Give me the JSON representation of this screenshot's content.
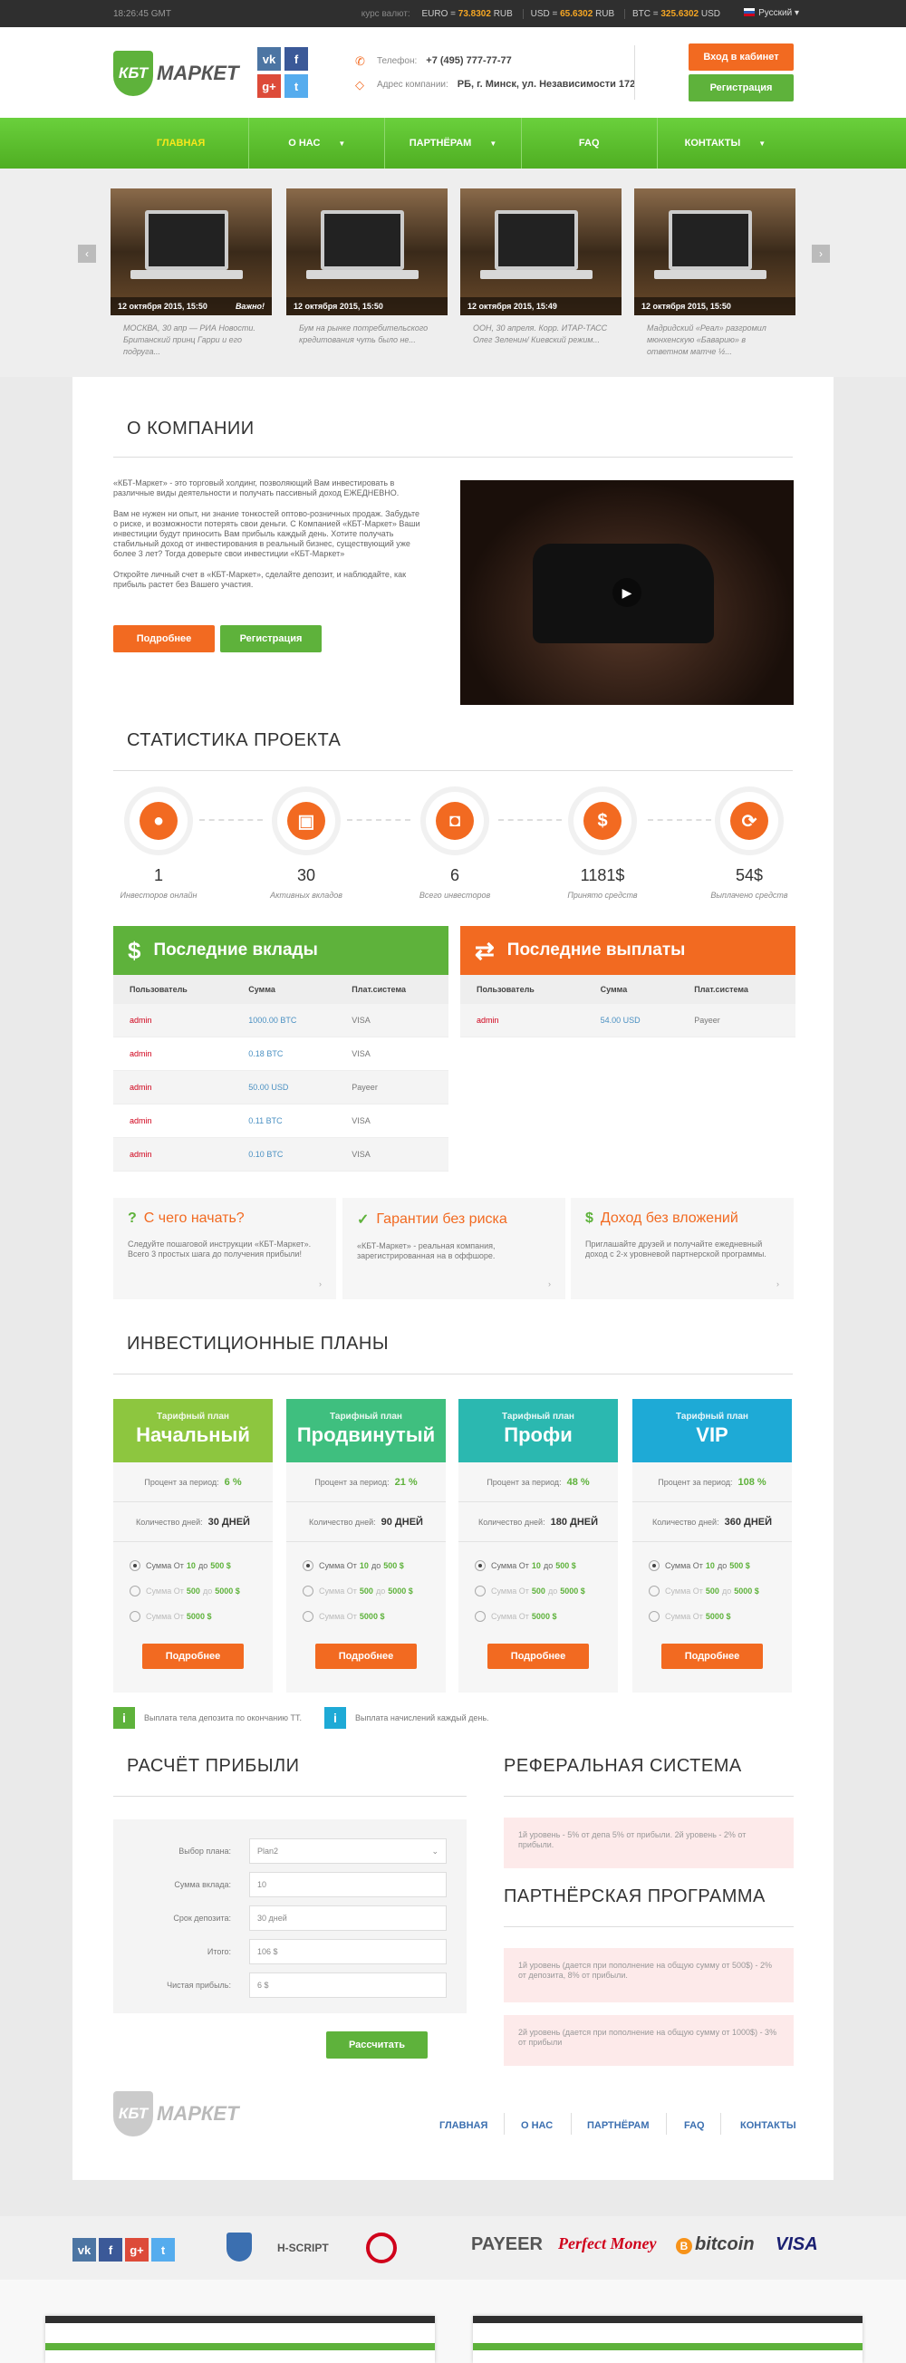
{
  "topbar": {
    "time": "18:26:45 GMT",
    "rates_label": "курс валют:",
    "euro_label": "EURO =",
    "euro_value": "73.8302",
    "euro_unit": "RUB",
    "usd_label": "USD =",
    "usd_value": "65.6302",
    "usd_unit": "RUB",
    "btc_label": "BTC =",
    "btc_value": "325.6302",
    "btc_unit": "USD",
    "language": "Русский"
  },
  "header": {
    "logo_mark": "КБТ",
    "logo_text": "МАРКЕТ",
    "phone_label": "Телефон:",
    "phone": "+7 (495) 777-77-77",
    "address_label": "Адрес компании:",
    "address": "РБ, г. Минск, ул. Независимости 172",
    "cabinet_button": "Вход в кабинет",
    "register_button": "Регистрация",
    "social": [
      "vk",
      "f",
      "g+",
      "t"
    ]
  },
  "nav": [
    {
      "label": "ГЛАВНАЯ"
    },
    {
      "label": "О НАС",
      "dropdown": true
    },
    {
      "label": "ПАРТНЁРАМ",
      "dropdown": true
    },
    {
      "label": "FAQ"
    },
    {
      "label": "КОНТАКТЫ",
      "dropdown": true
    }
  ],
  "slider": [
    {
      "date": "12 октября 2015, 15:50",
      "tag": "Важно!",
      "caption": "МОСКВА, 30 апр — РИА Новости. Британский принц Гарри и его подруга..."
    },
    {
      "date": "12 октября 2015, 15:50",
      "tag": "",
      "caption": "Бум на рынке потребительского кредитования чуть было не..."
    },
    {
      "date": "12 октября 2015, 15:49",
      "tag": "",
      "caption": "ООН, 30 апреля. Корр. ИТАР-ТАСС Олег Зеленин/ Киевский режим..."
    },
    {
      "date": "12 октября 2015, 15:50",
      "tag": "",
      "caption": "Мадридский «Реал» разгромил мюнхенскую «Баварию» в ответном матче ½..."
    }
  ],
  "about": {
    "title": "О КОМПАНИИ",
    "p1": "«КБТ-Маркет» - это торговый холдинг, позволяющий Вам инвестировать в различные виды деятельности и получать пассивный доход ЕЖЕДНЕВНО.",
    "p2": "Вам не нужен ни опыт, ни знание тонкостей оптово-розничных продаж. Забудьте о риске, и возможности потерять свои деньги. С Компанией «КБТ-Маркет» Ваши инвестиции будут приносить Вам прибыль каждый день. Хотите получать стабильный доход от инвестирования в реальный бизнес, существующий уже более 3 лет? Тогда доверьте свои инвестиции «КБТ-Маркет»",
    "p3": "Откройте личный счет в «КБТ-Маркет», сделайте депозит, и наблюдайте, как прибыль растет без Вашего участия.",
    "more_button": "Подробнее",
    "register_button": "Регистрация"
  },
  "stats": {
    "title": "СТАТИСТИКА ПРОЕКТА",
    "items": [
      {
        "icon": "user-icon",
        "glyph": "●",
        "value": "1",
        "label": "Инвесторов онлайн"
      },
      {
        "icon": "wallet-icon",
        "glyph": "▣",
        "value": "30",
        "label": "Активных вкладов"
      },
      {
        "icon": "investors-icon",
        "glyph": "◘",
        "value": "6",
        "label": "Всего инвесторов"
      },
      {
        "icon": "dollar-icon",
        "glyph": "$",
        "value": "1181$",
        "label": "Принято средств"
      },
      {
        "icon": "refresh-icon",
        "glyph": "⟳",
        "value": "54$",
        "label": "Выплачено средств"
      }
    ]
  },
  "deposits": {
    "title": "Последние вклады",
    "columns": [
      "Пользователь",
      "Сумма",
      "Плат.система"
    ],
    "rows": [
      [
        "admin",
        "1000.00 BTC",
        "VISA"
      ],
      [
        "admin",
        "0.18 BTC",
        "VISA"
      ],
      [
        "admin",
        "50.00 USD",
        "Payeer"
      ],
      [
        "admin",
        "0.11 BTC",
        "VISA"
      ],
      [
        "admin",
        "0.10 BTC",
        "VISA"
      ]
    ]
  },
  "payouts": {
    "title": "Последние выплаты",
    "columns": [
      "Пользователь",
      "Сумма",
      "Плат.система"
    ],
    "rows": [
      [
        "admin",
        "54.00 USD",
        "Payeer"
      ]
    ]
  },
  "info": [
    {
      "icon": "?",
      "title": "С чего начать?",
      "text": "Следуйте пошаговой инструкции «КБТ-Маркет». Всего 3 простых шага до получения прибыли!"
    },
    {
      "icon": "✓",
      "title": "Гарантии без риска",
      "text": "«КБТ-Маркет» - реальная компания, зарегистрированная на в оффшоре."
    },
    {
      "icon": "$",
      "title": "Доход без вложений",
      "text": "Приглашайте друзей и получайте ежедневный доход с 2-х уровневой партнерской программы."
    }
  ],
  "plans": {
    "title": "ИНВЕСТИЦИОННЫЕ ПЛАНЫ",
    "subtitle": "Тарифный план",
    "percent_label": "Процент за период:",
    "days_label": "Количество дней:",
    "sum_label": "Сумма",
    "from": "От",
    "to": "до",
    "button": "Подробнее",
    "items": [
      {
        "name": "Начальный",
        "color": "#8dc63f",
        "percent": "6 %",
        "days": "30 ДНЕЙ",
        "ranges": [
          [
            "10",
            "500 $"
          ],
          [
            "500",
            "5000 $"
          ],
          [
            "5000 $",
            ""
          ]
        ]
      },
      {
        "name": "Продвинутый",
        "color": "#3fbf7f",
        "percent": "21 %",
        "days": "90 ДНЕЙ",
        "ranges": [
          [
            "10",
            "500 $"
          ],
          [
            "500",
            "5000 $"
          ],
          [
            "5000 $",
            ""
          ]
        ]
      },
      {
        "name": "Профи",
        "color": "#2bb8b0",
        "percent": "48 %",
        "days": "180 ДНЕЙ",
        "ranges": [
          [
            "10",
            "500 $"
          ],
          [
            "500",
            "5000 $"
          ],
          [
            "5000 $",
            ""
          ]
        ]
      },
      {
        "name": "VIP",
        "color": "#1eaad6",
        "percent": "108 %",
        "days": "360 ДНЕЙ",
        "ranges": [
          [
            "10",
            "500 $"
          ],
          [
            "500",
            "5000 $"
          ],
          [
            "5000 $",
            ""
          ]
        ]
      }
    ]
  },
  "notes": [
    "Выплата тела депозита по окончанию TT.",
    "Выплата начислений каждый день."
  ],
  "calc": {
    "title": "РАСЧЁТ ПРИБЫЛИ",
    "fields": [
      {
        "label": "Выбор плана:",
        "value": "Plan2"
      },
      {
        "label": "Сумма вклада:",
        "value": "10"
      },
      {
        "label": "Срок депозита:",
        "value": "30 дней"
      },
      {
        "label": "Итого:",
        "value": "106 $"
      },
      {
        "label": "Чистая прибыль:",
        "value": "6 $"
      }
    ],
    "button": "Рассчитать"
  },
  "referral": {
    "title": "РЕФЕРАЛЬНАЯ СИСТЕМА",
    "text": "1й уровень - 5% от депа 5% от прибыли. 2й уровень - 2% от прибыли.",
    "partner_title": "ПАРТНЁРСКАЯ ПРОГРАММА",
    "partner1": "1й уровень (дается при пополнение на общую сумму от 500$) - 2% от депозита, 8% от прибыли.",
    "partner2": "2й уровень (дается при пополнение на общую сумму от 1000$) - 3% от прибыли"
  },
  "footer_nav": [
    "ГЛАВНАЯ",
    "О НАС",
    "ПАРТНЁРАМ",
    "FAQ",
    "КОНТАКТЫ"
  ],
  "footer": {
    "hscript": "H-SCRIPT",
    "payeer": "PAYEER",
    "perfect": "Perfect Money",
    "bitcoin": "bitcoin",
    "visa": "VISA"
  },
  "colors": {
    "green": "#5eb23b",
    "orange": "#f26a21",
    "blue": "#3b6fb0"
  }
}
